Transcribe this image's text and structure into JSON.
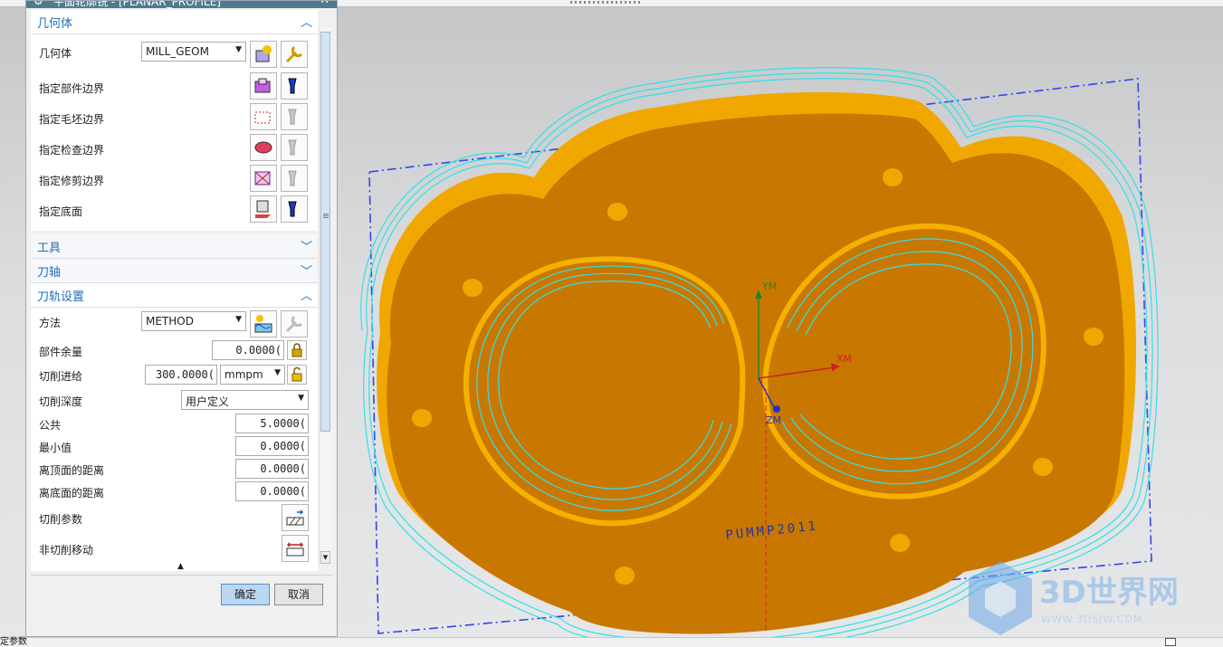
{
  "dialog": {
    "title": "平面轮廓铣 - [PLANAR_PROFILE]",
    "ok_label": "确定",
    "cancel_label": "取消"
  },
  "geometry_section": {
    "title": "几何体",
    "geometry_label": "几何体",
    "geometry_value": "MILL_GEOM",
    "rows": [
      {
        "label": "指定部件边界"
      },
      {
        "label": "指定毛坯边界"
      },
      {
        "label": "指定检查边界"
      },
      {
        "label": "指定修剪边界"
      },
      {
        "label": "指定底面"
      }
    ]
  },
  "tool_section": {
    "title": "工具"
  },
  "axis_section": {
    "title": "刀轴"
  },
  "path_section": {
    "title": "刀轨设置",
    "method_label": "方法",
    "method_value": "METHOD",
    "part_stock_label": "部件余量",
    "part_stock_value": "0.0000(",
    "feed_label": "切削进给",
    "feed_value": "300.0000(",
    "feed_unit": "mmpm",
    "depth_label": "切削深度",
    "depth_value": "用户定义",
    "common_label": "公共",
    "common_value": "5.0000(",
    "min_label": "最小值",
    "min_value": "0.0000(",
    "top_dist_label": "离顶面的距离",
    "top_dist_value": "0.0000(",
    "bottom_dist_label": "离底面的距离",
    "bottom_dist_value": "0.0000(",
    "cut_params_label": "切削参数",
    "noncut_label": "非切削移动"
  },
  "viewport": {
    "axis_xm": "XM",
    "axis_ym": "YM",
    "axis_zm": "ZM",
    "part_text": "PUMMP2011",
    "watermark_title": "3D世界网",
    "watermark_url": "WWW.3DSJW.COM"
  },
  "statusbar": {
    "text": "定参数"
  },
  "colors": {
    "part_fill": "#c87800",
    "part_wall": "#f0a800",
    "toolpath": "#33e0e8",
    "wcs_box": "#3344ee",
    "accent": "#1e6fb8"
  }
}
